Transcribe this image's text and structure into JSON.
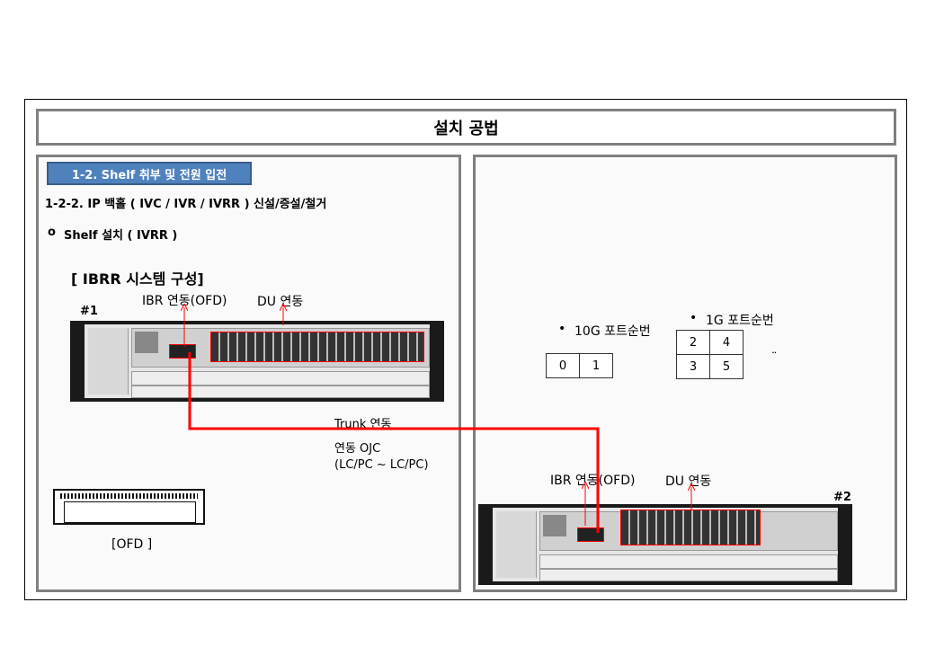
{
  "header": {
    "title": "설치 공법"
  },
  "left": {
    "section_label": "1-2. Shelf 취부 및 전원 입전",
    "subtitle": "1-2-2. IP 백홀 ( IVC / IVR / IVRR ) 신설/증설/철거",
    "bullet_marker": "o",
    "bullet_text": "Shelf 설치 ( IVRR )",
    "system_heading": "[ IBRR 시스템 구성]",
    "ibr_label": "IBR 연동(OFD)",
    "du_label": "DU 연동",
    "unit1_label": "#1",
    "ofd_caption": "[OFD ]"
  },
  "trunk": {
    "label": "Trunk 연동",
    "ojc_line1": "연동 OJC",
    "ojc_line2": "(LC/PC ~ LC/PC)"
  },
  "right": {
    "port10g_title": "10G 포트순번",
    "port10g_cells": [
      "0",
      "1"
    ],
    "port1g_title": "1G 포트순번",
    "port1g_rows": [
      [
        "2",
        "4"
      ],
      [
        "3",
        "5"
      ]
    ],
    "ellipsis": "¨",
    "ibr_label": "IBR 연동(OFD)",
    "du_label": "DU 연동",
    "unit2_label": "#2"
  },
  "colors": {
    "accent_blue": "#4f81bd",
    "link_red": "#ff0000",
    "border_gray": "#7f7f7f"
  },
  "icons": {
    "bullet": "•",
    "arrow": "up-arrow-icon"
  }
}
